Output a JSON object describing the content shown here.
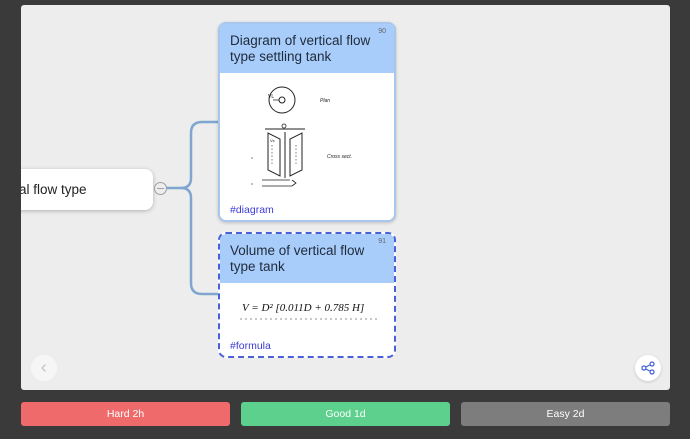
{
  "mindmap": {
    "root_label": "al flow type",
    "cards": [
      {
        "number": "90",
        "title": "Diagram of vertical flow type settling tank",
        "tag": "#diagram",
        "sketch_labels": {
          "plan": "Plan",
          "cross_section": "Cross sect.",
          "vl": "VL",
          "vs": "Vs"
        }
      },
      {
        "number": "91",
        "title": "Volume of vertical flow type tank",
        "tag": "#formula",
        "formula": "V = D² [0.011D + 0.785 H]"
      }
    ]
  },
  "controls": {
    "prev_icon": "chevron-left-icon",
    "share_icon": "share-icon"
  },
  "answer_buttons": {
    "hard": "Hard 2h",
    "good": "Good 1d",
    "easy": "Easy 2d"
  },
  "colors": {
    "card_header": "#a8cdfb",
    "selected_border": "#4a60d8",
    "hard": "#ef6b6b",
    "good": "#5cd08c",
    "easy": "#7d7d7d"
  }
}
